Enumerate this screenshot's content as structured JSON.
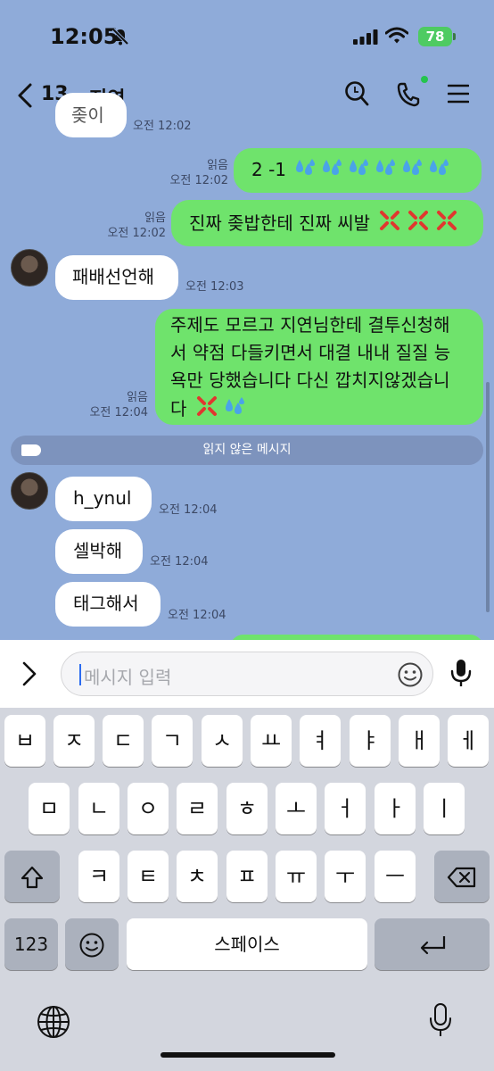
{
  "status_bar": {
    "time": "12:05",
    "battery": "78"
  },
  "header": {
    "unread_count": "13",
    "title": "지연"
  },
  "messages": [
    {
      "dir": "in",
      "text": "좆이",
      "time": "오전 12:02"
    },
    {
      "dir": "out",
      "text": "2 -1",
      "read": "읽음",
      "time": "오전 12:02",
      "emoji": "sweat-droplets"
    },
    {
      "dir": "out",
      "text": "진짜 좆밥한테 진짜 씨발",
      "read": "읽음",
      "time": "오전 12:02",
      "emoji": "anger-symbol"
    },
    {
      "dir": "in",
      "text": "패배선언해",
      "time": "오전 12:03"
    },
    {
      "dir": "out",
      "lines": [
        "주제도 모르고 지연님한테 결투신청해",
        "서 약점 다들키면서 대결 내내 질질 능",
        "욕만 당했습니다 다신 깝치지않겠습니",
        "다"
      ],
      "read": "읽음",
      "time": "오전 12:04",
      "emoji": "anger-and-sweat"
    },
    {
      "dir": "in",
      "text": "h_ynul",
      "time": "오전 12:04"
    },
    {
      "dir": "in",
      "text": "셀박해",
      "time": "오전 12:04"
    },
    {
      "dir": "in",
      "text": "태그해서",
      "time": "오전 12:04"
    }
  ],
  "unread_divider": "읽지 않은 메시지",
  "input": {
    "placeholder": "메시지 입력"
  },
  "keyboard": {
    "row1": [
      "ㅂ",
      "ㅈ",
      "ㄷ",
      "ㄱ",
      "ㅅ",
      "ㅛ",
      "ㅕ",
      "ㅑ",
      "ㅐ",
      "ㅔ"
    ],
    "row2": [
      "ㅁ",
      "ㄴ",
      "ㅇ",
      "ㄹ",
      "ㅎ",
      "ㅗ",
      "ㅓ",
      "ㅏ",
      "ㅣ"
    ],
    "row3": [
      "ㅋ",
      "ㅌ",
      "ㅊ",
      "ㅍ",
      "ㅠ",
      "ㅜ",
      "ㅡ"
    ],
    "numbers_key": "123",
    "space_key": "스페이스"
  },
  "colors": {
    "chat_bg": "#8fabd9",
    "out_bubble": "#6fe36c",
    "in_bubble": "#ffffff",
    "online_dot": "#25c44e"
  }
}
